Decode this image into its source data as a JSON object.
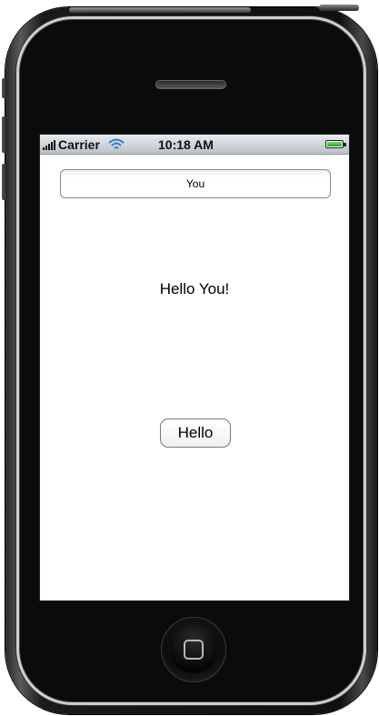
{
  "status_bar": {
    "carrier": "Carrier",
    "time": "10:18 AM",
    "signal_icon": "signal-bars-icon",
    "wifi_icon": "wifi-icon",
    "battery_icon": "battery-icon",
    "battery_color": "#2fbf2a"
  },
  "app": {
    "name_field_value": "You",
    "greeting": "Hello You!",
    "hello_button_label": "Hello"
  },
  "device": {
    "home_icon": "home-button-icon",
    "speaker_icon": "speaker-grille-icon"
  }
}
